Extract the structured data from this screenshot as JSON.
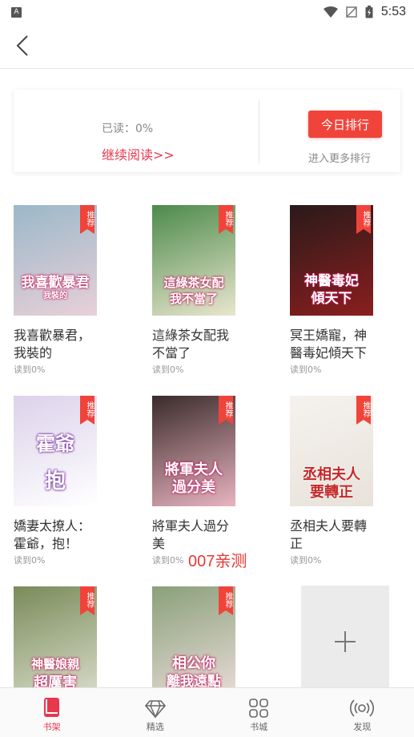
{
  "status_bar": {
    "app_badge": "A",
    "time": "5:53"
  },
  "reading_card": {
    "progress_text": "已读：0%",
    "continue_label": "继续阅读>>",
    "rank_button_label": "今日排行",
    "more_rank_label": "进入更多排行"
  },
  "books": [
    {
      "title": "我喜歡暴君，我裝的",
      "progress": "读到0%",
      "cover_text": "我喜歡暴君",
      "cover_sub": "我裝的",
      "tag": "推荐",
      "colors": [
        "#9bb8c9",
        "#e8d0d8"
      ]
    },
    {
      "title": "這綠茶女配我不當了",
      "progress": "读到0%",
      "cover_text": "這綠茶女配",
      "cover_sub": "我不當了",
      "tag": "推荐",
      "colors": [
        "#4c8a4a",
        "#e9e6cf"
      ]
    },
    {
      "title": "冥王嬌寵，神醫毒妃傾天下",
      "progress": "读到0%",
      "cover_text": "神醫毒妃",
      "cover_sub": "傾天下",
      "tag": "推荐",
      "colors": [
        "#2a1a1a",
        "#8b1e1e"
      ]
    },
    {
      "title": "嬌妻太撩人：霍爺，抱！",
      "progress": "读到0%",
      "cover_text": "霍爺",
      "cover_sub": "抱",
      "tag": "推荐",
      "colors": [
        "#dcd2ea",
        "#ffffff"
      ]
    },
    {
      "title": "將軍夫人過分美",
      "progress": "读到0%",
      "cover_text": "將軍夫人",
      "cover_sub": "過分美",
      "tag": "推荐",
      "colors": [
        "#3a2b2b",
        "#e8b4c0"
      ]
    },
    {
      "title": "丞相夫人要轉正",
      "progress": "读到0%",
      "cover_text": "丞相夫人",
      "cover_sub": "要轉正",
      "tag": "推荐",
      "colors": [
        "#f5f2ee",
        "#e8e2da"
      ]
    },
    {
      "title": "",
      "progress": "",
      "cover_text": "神醫娘親",
      "cover_sub": "超厲害",
      "tag": "推荐",
      "colors": [
        "#7a8b5a",
        "#d8dcc9"
      ]
    },
    {
      "title": "",
      "progress": "",
      "cover_text": "相公你",
      "cover_sub": "離我遠點",
      "tag": "推荐",
      "colors": [
        "#8aa07a",
        "#e9dcd8"
      ]
    }
  ],
  "watermark": "007亲测",
  "tabs": [
    {
      "label": "书架",
      "icon": "bookshelf-icon",
      "active": true
    },
    {
      "label": "精选",
      "icon": "diamond-icon",
      "active": false
    },
    {
      "label": "书城",
      "icon": "grid-icon",
      "active": false
    },
    {
      "label": "发现",
      "icon": "broadcast-icon",
      "active": false
    }
  ],
  "colors": {
    "accent": "#e8374e",
    "rank_button": "#f0443b"
  }
}
